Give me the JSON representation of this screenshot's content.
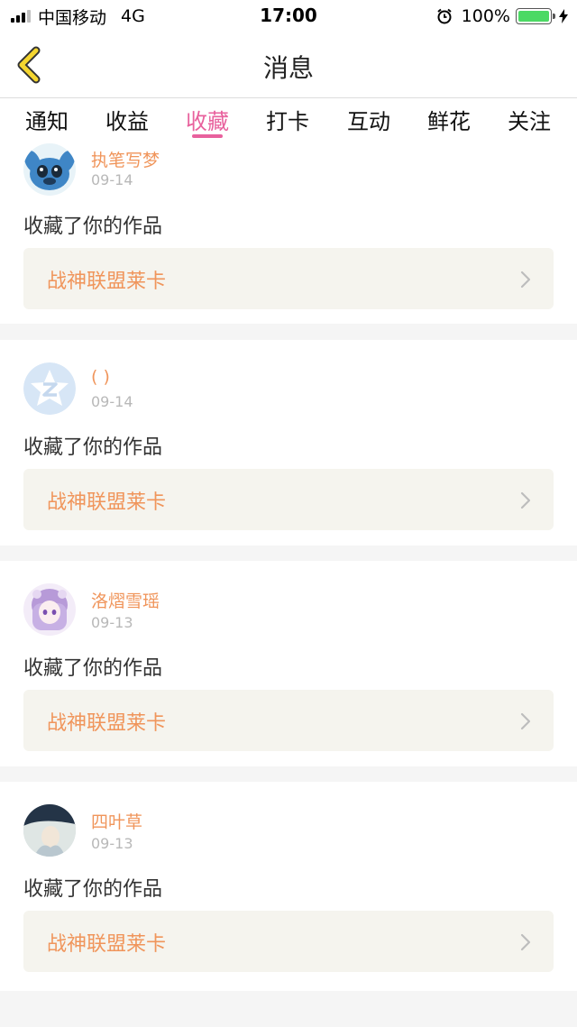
{
  "status_bar": {
    "carrier": "中国移动",
    "network": "4G",
    "time": "17:00",
    "battery": "100%",
    "battery_level": 1.0,
    "battery_color": "#4cd964"
  },
  "nav": {
    "title": "消息",
    "back_icon": "chevron-left-icon"
  },
  "tabs": [
    {
      "label": "通知",
      "active": false
    },
    {
      "label": "收益",
      "active": false
    },
    {
      "label": "收藏",
      "active": true
    },
    {
      "label": "打卡",
      "active": false
    },
    {
      "label": "互动",
      "active": false
    },
    {
      "label": "鲜花",
      "active": false
    },
    {
      "label": "关注",
      "active": false
    }
  ],
  "colors": {
    "accent": "#e8619d",
    "username": "#f0955b",
    "link_bg": "#f5f4ee"
  },
  "messages": [
    {
      "user": "执笔写梦",
      "date": "09-14",
      "text": "收藏了你的作品",
      "work": "战神联盟莱卡",
      "avatar_icon": "stitch-avatar-icon"
    },
    {
      "user": "( )",
      "date": "09-14",
      "text": "收藏了你的作品",
      "work": "战神联盟莱卡",
      "avatar_icon": "qzone-star-avatar-icon"
    },
    {
      "user": "洛熠雪瑶",
      "date": "09-13",
      "text": "收藏了你的作品",
      "work": "战神联盟莱卡",
      "avatar_icon": "anime-girl-avatar-icon"
    },
    {
      "user": "四叶草",
      "date": "09-13",
      "text": "收藏了你的作品",
      "work": "战神联盟莱卡",
      "avatar_icon": "photo-avatar-icon"
    }
  ]
}
